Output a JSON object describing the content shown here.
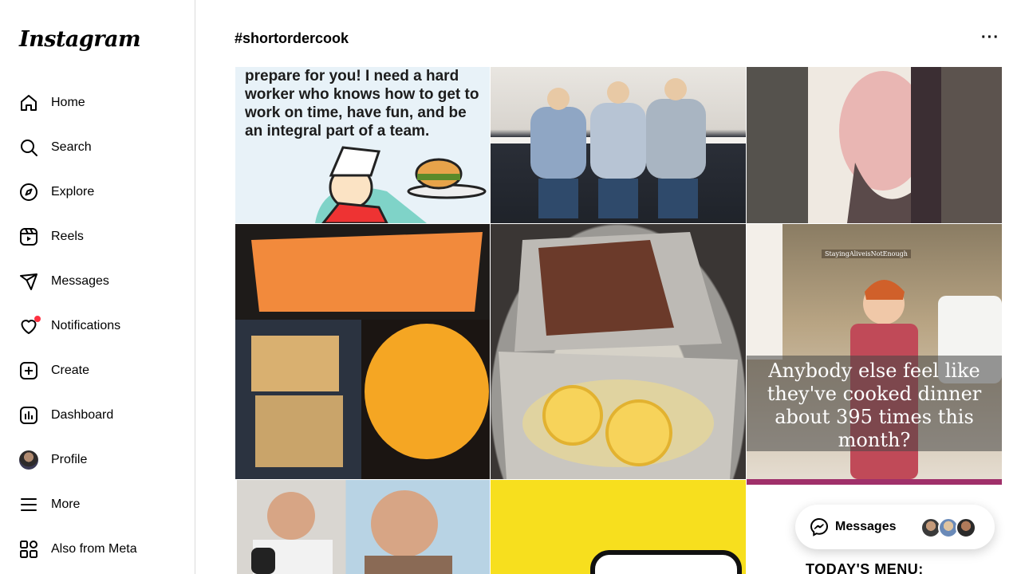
{
  "app": {
    "logo_text": "Instagram"
  },
  "sidebar": {
    "items": [
      {
        "label": "Home",
        "icon": "home-icon"
      },
      {
        "label": "Search",
        "icon": "search-icon"
      },
      {
        "label": "Explore",
        "icon": "compass-icon"
      },
      {
        "label": "Reels",
        "icon": "reels-icon"
      },
      {
        "label": "Messages",
        "icon": "messenger-icon"
      },
      {
        "label": "Notifications",
        "icon": "heart-icon"
      },
      {
        "label": "Create",
        "icon": "plus-square-icon"
      },
      {
        "label": "Dashboard",
        "icon": "dashboard-icon"
      },
      {
        "label": "Profile",
        "icon": "avatar"
      },
      {
        "label": "More",
        "icon": "hamburger-icon"
      },
      {
        "label": "Also from Meta",
        "icon": "meta-apps-icon"
      }
    ]
  },
  "header": {
    "hashtag": "#shortordercook",
    "more": "···"
  },
  "posts": {
    "p1_text": "prepare for you! I need a hard worker who knows how to get to work on time, have fun, and be an integral part of a team.",
    "p6_tag": "StayingAliveisNotEnough",
    "p6_caption": "Anybody else feel like they've cooked dinner about 395 times this month?",
    "p9_text": "TODAY'S MENU:"
  },
  "messages_popup": {
    "label": "Messages"
  },
  "colors": {
    "notification_dot": "#ff3040",
    "border": "#dbdbdb",
    "accent_magenta": "#a0306a",
    "yellow": "#f7df1e"
  }
}
